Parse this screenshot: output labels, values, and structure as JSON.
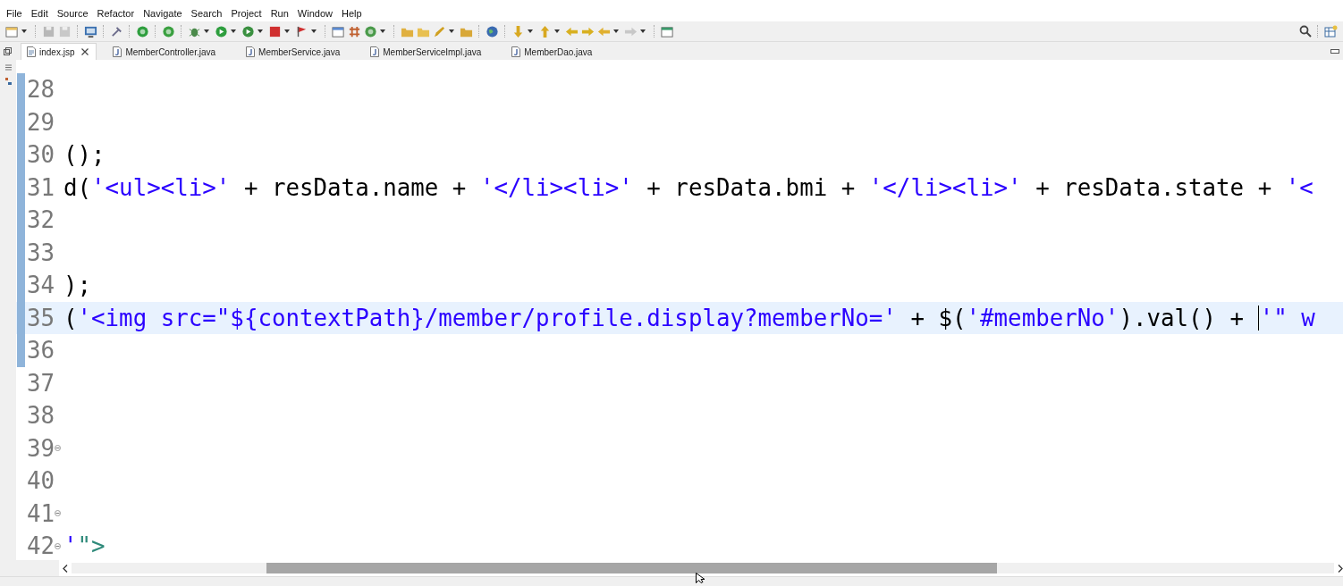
{
  "menu": [
    "File",
    "Edit",
    "Source",
    "Refactor",
    "Navigate",
    "Search",
    "Project",
    "Run",
    "Window",
    "Help"
  ],
  "tabs": [
    {
      "label": "index.jsp",
      "selected": true,
      "kind": "jsp"
    },
    {
      "label": "MemberController.java",
      "selected": false,
      "kind": "java"
    },
    {
      "label": "MemberService.java",
      "selected": false,
      "kind": "java"
    },
    {
      "label": "MemberServiceImpl.java",
      "selected": false,
      "kind": "java"
    },
    {
      "label": "MemberDao.java",
      "selected": false,
      "kind": "java"
    }
  ],
  "editor": {
    "lines": [
      {
        "number": "28",
        "changed": true,
        "current": false,
        "foldable": false
      },
      {
        "number": "29",
        "changed": true,
        "current": false,
        "foldable": false
      },
      {
        "number": "30",
        "changed": true,
        "current": false,
        "foldable": false,
        "segments": [
          {
            "text": "();",
            "kind": "plain"
          }
        ]
      },
      {
        "number": "31",
        "changed": true,
        "current": false,
        "foldable": false,
        "segments": [
          {
            "text": "d(",
            "kind": "plain"
          },
          {
            "text": "'<ul><li>'",
            "kind": "string"
          },
          {
            "text": " + resData.name + ",
            "kind": "plain"
          },
          {
            "text": "'</li><li>'",
            "kind": "string"
          },
          {
            "text": " + resData.bmi + ",
            "kind": "plain"
          },
          {
            "text": "'</li><li>'",
            "kind": "string"
          },
          {
            "text": " + resData.state + ",
            "kind": "plain"
          },
          {
            "text": "'<",
            "kind": "string"
          }
        ]
      },
      {
        "number": "32",
        "changed": true,
        "current": false,
        "foldable": false
      },
      {
        "number": "33",
        "changed": true,
        "current": false,
        "foldable": false
      },
      {
        "number": "34",
        "changed": true,
        "current": false,
        "foldable": false,
        "segments": [
          {
            "text": ");",
            "kind": "plain"
          }
        ]
      },
      {
        "number": "35",
        "changed": true,
        "current": true,
        "foldable": false,
        "segments": [
          {
            "text": "(",
            "kind": "plain"
          },
          {
            "text": "'<img src=\"${contextPath}/member/profile.display?memberNo='",
            "kind": "string"
          },
          {
            "text": " + $(",
            "kind": "plain"
          },
          {
            "text": "'#memberNo'",
            "kind": "string"
          },
          {
            "text": ").val() + ",
            "kind": "plain"
          },
          {
            "text": "'\" w",
            "kind": "string",
            "caret": true
          }
        ]
      },
      {
        "number": "36",
        "changed": true,
        "current": false,
        "foldable": false
      },
      {
        "number": "37",
        "changed": false,
        "current": false,
        "foldable": false
      },
      {
        "number": "38",
        "changed": false,
        "current": false,
        "foldable": false
      },
      {
        "number": "39",
        "changed": false,
        "current": false,
        "foldable": true
      },
      {
        "number": "40",
        "changed": false,
        "current": false,
        "foldable": false
      },
      {
        "number": "41",
        "changed": false,
        "current": false,
        "foldable": true
      },
      {
        "number": "42",
        "changed": false,
        "current": false,
        "foldable": true,
        "segments": [
          {
            "text": "'",
            "kind": "string"
          },
          {
            "text": "\">",
            "kind": "tag"
          }
        ]
      }
    ]
  }
}
